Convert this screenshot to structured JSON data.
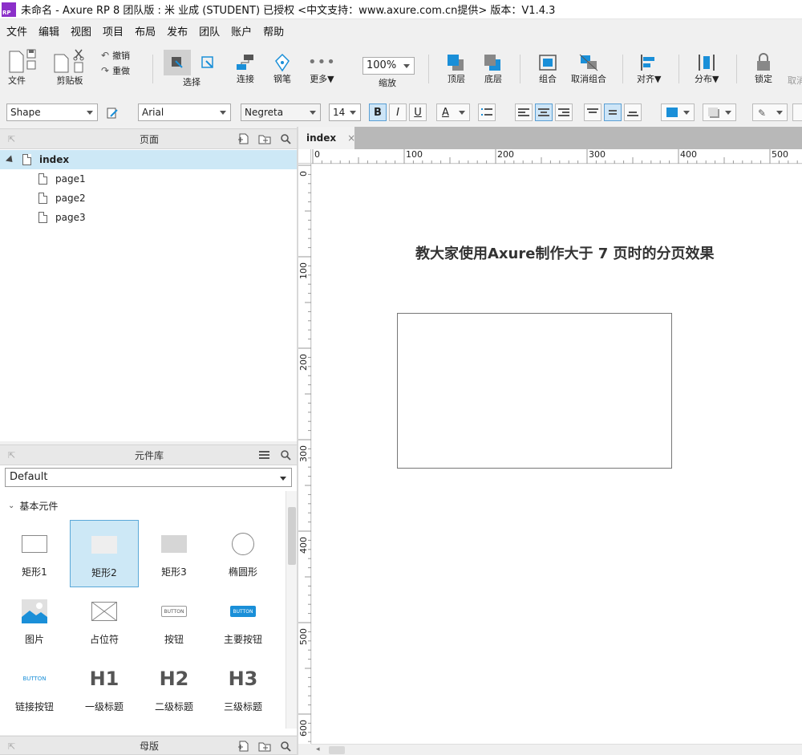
{
  "window": {
    "title": "未命名 - Axure RP 8 团队版 : 米 业成 (STUDENT) 已授权     <中文支持：www.axure.com.cn提供> 版本：V1.4.3",
    "logo_text": "RP",
    "ghost_text": "版本：V1.4.3"
  },
  "menu": [
    "文件",
    "编辑",
    "视图",
    "项目",
    "布局",
    "发布",
    "团队",
    "账户",
    "帮助"
  ],
  "toolbar": {
    "file_label": "文件",
    "clipboard_label": "剪贴板",
    "undo_label": "撤销",
    "redo_label": "重做",
    "select_label": "选择",
    "connect_label": "连接",
    "pen_label": "钢笔",
    "more_label": "更多▼",
    "zoom_value": "100%",
    "zoom_label": "缩放",
    "top_label": "顶层",
    "bottom_label": "底层",
    "group_label": "组合",
    "ungroup_label": "取消组合",
    "align_label": "对齐▼",
    "distribute_label": "分布▼",
    "lock_label": "锁定",
    "unlock_label": "取消"
  },
  "format": {
    "shape_type": "Shape",
    "font_family": "Arial",
    "font_weight": "Negreta",
    "font_size": "14",
    "bold": "B",
    "italic": "I",
    "underline": "U",
    "font_color": "A"
  },
  "pages_panel": {
    "title": "页面",
    "pages": [
      {
        "name": "index",
        "selected": true,
        "level": 0
      },
      {
        "name": "page1",
        "selected": false,
        "level": 1
      },
      {
        "name": "page2",
        "selected": false,
        "level": 1
      },
      {
        "name": "page3",
        "selected": false,
        "level": 1
      }
    ]
  },
  "library_panel": {
    "title": "元件库",
    "selected_library": "Default",
    "section": "基本元件",
    "widgets": [
      {
        "label": "矩形1",
        "icon": "rect-outline-icon"
      },
      {
        "label": "矩形2",
        "icon": "rect-light-icon",
        "selected": true
      },
      {
        "label": "矩形3",
        "icon": "rect-gray-icon"
      },
      {
        "label": "椭圆形",
        "icon": "ellipse-icon"
      },
      {
        "label": "图片",
        "icon": "image-icon"
      },
      {
        "label": "占位符",
        "icon": "placeholder-icon"
      },
      {
        "label": "按钮",
        "icon": "button-icon",
        "icon_text": "BUTTON"
      },
      {
        "label": "主要按钮",
        "icon": "primary-button-icon",
        "icon_text": "BUTTON"
      },
      {
        "label": "链接按钮",
        "icon": "link-button-icon",
        "icon_text": "BUTTON"
      },
      {
        "label": "一级标题",
        "icon": "h1-icon",
        "icon_text": "H1"
      },
      {
        "label": "二级标题",
        "icon": "h2-icon",
        "icon_text": "H2"
      },
      {
        "label": "三级标题",
        "icon": "h3-icon",
        "icon_text": "H3"
      }
    ]
  },
  "masters_panel": {
    "title": "母版"
  },
  "canvas": {
    "tab_name": "index",
    "tab_close": "×",
    "ruler_h_labels": [
      "0",
      "100",
      "200",
      "300",
      "400",
      "500"
    ],
    "ruler_v_labels": [
      "0",
      "100",
      "200",
      "300",
      "400",
      "500",
      "600"
    ],
    "heading": "教大家使用Axure制作大于 7 页时的分页效果"
  },
  "colors": {
    "accent": "#1a8fd8",
    "selection": "#cde8f6",
    "logo": "#8b2fc9"
  }
}
